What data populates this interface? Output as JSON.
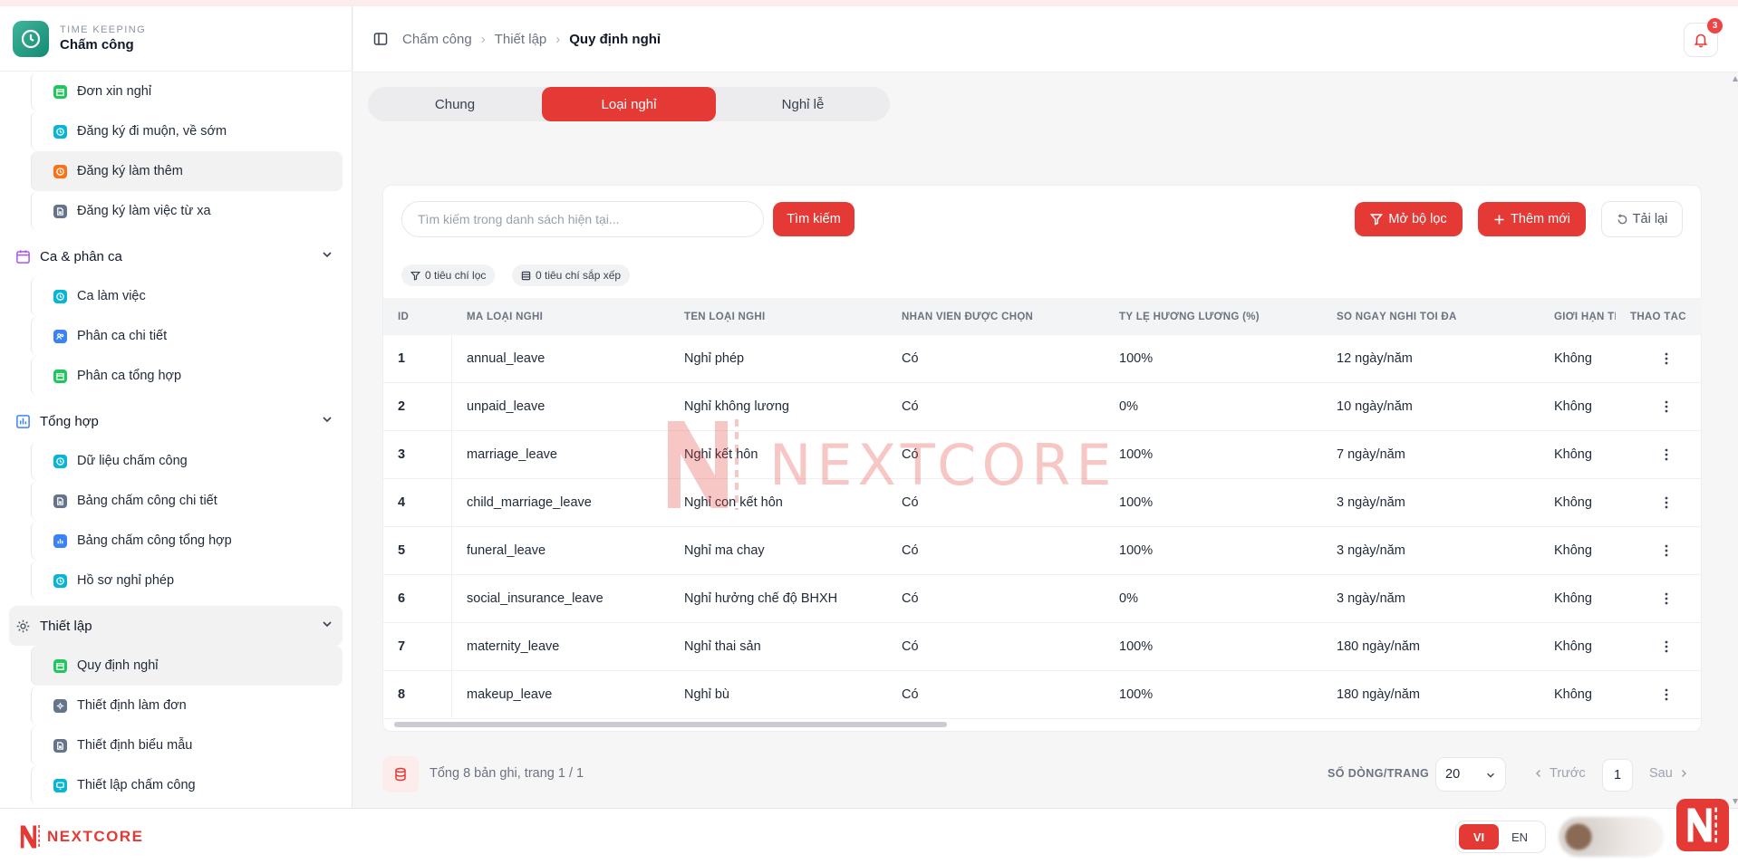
{
  "app": {
    "subtitle": "TIME KEEPING",
    "title": "Chấm công"
  },
  "sidebar": {
    "top_items": [
      {
        "label": "Đơn xin nghỉ",
        "icon": "calendar-icon",
        "color": "#22c55e"
      },
      {
        "label": "Đăng ký đi muộn, về sớm",
        "icon": "clock-icon",
        "color": "#06b6d4"
      },
      {
        "label": "Đăng ký làm thêm",
        "icon": "clock-icon",
        "color": "#f97316"
      },
      {
        "label": "Đăng ký làm việc từ xa",
        "icon": "document-icon",
        "color": "#64748b"
      }
    ],
    "groups": [
      {
        "label": "Ca & phân ca",
        "icon": "calendar-group-icon",
        "items": [
          {
            "label": "Ca làm việc",
            "icon": "clock-icon",
            "color": "#06b6d4"
          },
          {
            "label": "Phân ca chi tiết",
            "icon": "users-icon",
            "color": "#3b82f6"
          },
          {
            "label": "Phân ca tổng hợp",
            "icon": "calendar-icon",
            "color": "#22c55e"
          }
        ]
      },
      {
        "label": "Tổng hợp",
        "icon": "chart-group-icon",
        "items": [
          {
            "label": "Dữ liệu chấm công",
            "icon": "clock-icon",
            "color": "#06b6d4"
          },
          {
            "label": "Bảng chấm công chi tiết",
            "icon": "document-icon",
            "color": "#64748b"
          },
          {
            "label": "Bảng chấm công tổng hợp",
            "icon": "chart-icon",
            "color": "#3b82f6"
          },
          {
            "label": "Hồ sơ nghỉ phép",
            "icon": "clock-icon",
            "color": "#06b6d4"
          }
        ]
      },
      {
        "label": "Thiết lập",
        "icon": "settings-group-icon",
        "items": [
          {
            "label": "Quy định nghỉ",
            "icon": "calendar-icon",
            "color": "#22c55e"
          },
          {
            "label": "Thiết định làm đơn",
            "icon": "gear-icon",
            "color": "#64748b"
          },
          {
            "label": "Thiết định biểu mẫu",
            "icon": "document-icon",
            "color": "#64748b"
          },
          {
            "label": "Thiết lập chấm công",
            "icon": "monitor-icon",
            "color": "#06b6d4"
          }
        ]
      }
    ]
  },
  "header": {
    "breadcrumb": [
      "Chấm công",
      "Thiết lập",
      "Quy định nghỉ"
    ],
    "notification_count": "3"
  },
  "tabs": [
    "Chung",
    "Loại nghỉ",
    "Nghỉ lễ"
  ],
  "toolbar": {
    "search_placeholder": "Tìm kiếm trong danh sách hiện tại...",
    "search_button": "Tìm kiếm",
    "filter_button": "Mở bộ lọc",
    "add_button": "Thêm mới",
    "reload_button": "Tải lại",
    "filter_chip": "0 tiêu chí lọc",
    "sort_chip": "0 tiêu chí sắp xếp"
  },
  "table": {
    "columns": [
      "ID",
      "MÃ LOẠI NGHỈ",
      "TÊN LOẠI NGHỈ",
      "NHÂN VIÊN ĐƯỢC CHỌN",
      "TỶ LỆ HƯỞNG LƯƠNG (%)",
      "SỐ NGÀY NGHỈ TỐI ĐA",
      "GIỚI HẠN TI",
      "THAO TÁC"
    ],
    "rows": [
      [
        "1",
        "annual_leave",
        "Nghỉ phép",
        "Có",
        "100%",
        "12 ngày/năm",
        "Không"
      ],
      [
        "2",
        "unpaid_leave",
        "Nghỉ không lương",
        "Có",
        "0%",
        "10 ngày/năm",
        "Không"
      ],
      [
        "3",
        "marriage_leave",
        "Nghỉ kết hôn",
        "Có",
        "100%",
        "7 ngày/năm",
        "Không"
      ],
      [
        "4",
        "child_marriage_leave",
        "Nghỉ con kết hôn",
        "Có",
        "100%",
        "3 ngày/năm",
        "Không"
      ],
      [
        "5",
        "funeral_leave",
        "Nghỉ ma chay",
        "Có",
        "100%",
        "3 ngày/năm",
        "Không"
      ],
      [
        "6",
        "social_insurance_leave",
        "Nghỉ hưởng chế độ BHXH",
        "Có",
        "0%",
        "3 ngày/năm",
        "Không"
      ],
      [
        "7",
        "maternity_leave",
        "Nghỉ thai sản",
        "Có",
        "100%",
        "180 ngày/năm",
        "Không"
      ],
      [
        "8",
        "makeup_leave",
        "Nghỉ bù",
        "Có",
        "100%",
        "180 ngày/năm",
        "Không"
      ]
    ]
  },
  "pager": {
    "total_text": "Tổng 8 bản ghi, trang 1 / 1",
    "rows_label": "SỐ DÒNG/TRANG",
    "rows_value": "20",
    "prev": "Trước",
    "page": "1",
    "next": "Sau"
  },
  "footer": {
    "brand": "NEXTCORE",
    "lang_vi": "VI",
    "lang_en": "EN"
  },
  "watermark": "NEXTCORE",
  "colors": {
    "accent": "#e53935",
    "brand_teal": "#1f9e84"
  }
}
